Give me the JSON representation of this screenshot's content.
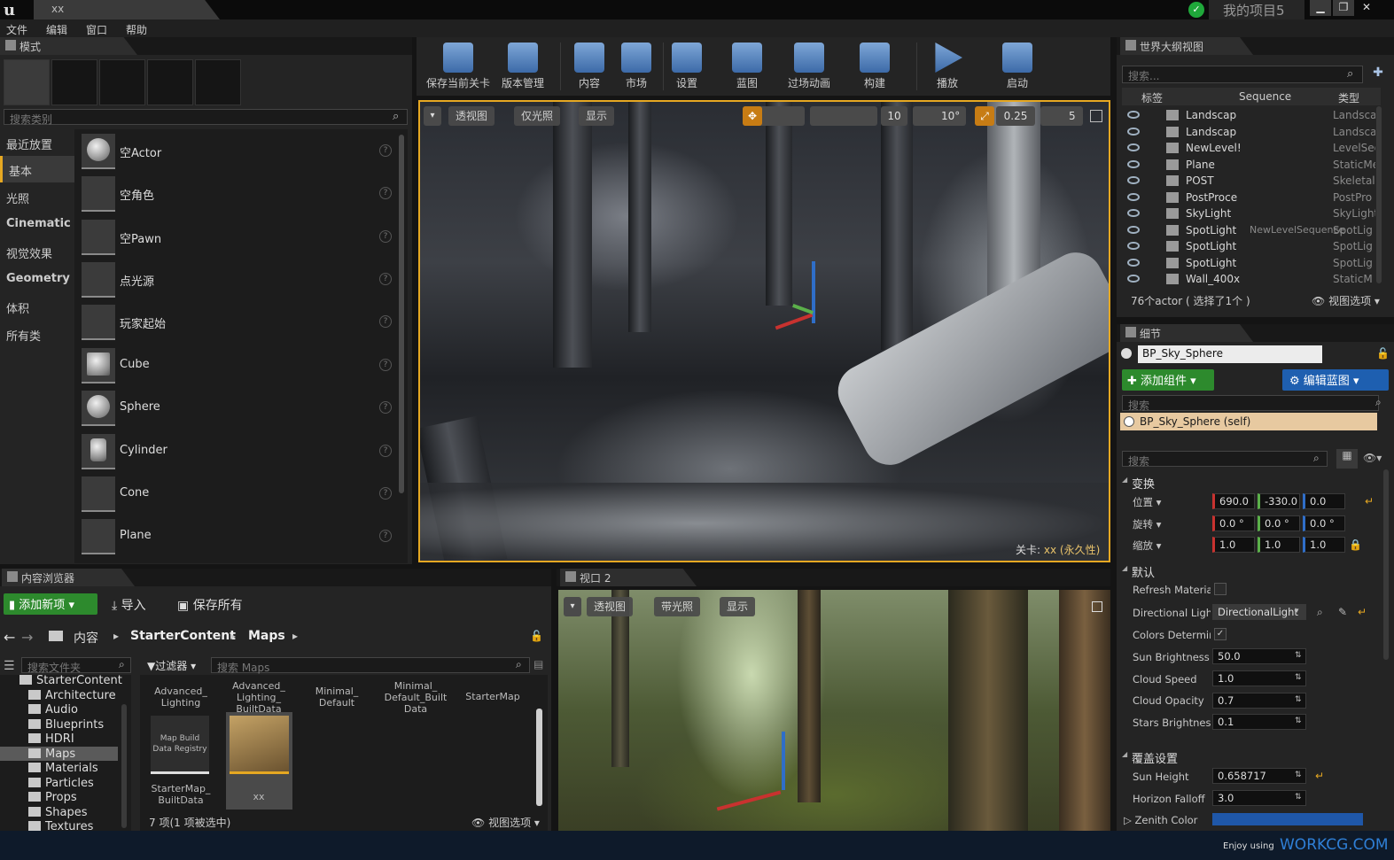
{
  "titlebar": {
    "doc_tab": "xx",
    "project": "我的项目5"
  },
  "menu": [
    "文件",
    "编辑",
    "窗口",
    "帮助"
  ],
  "modes": {
    "tab": "模式",
    "search_placeholder": "搜索类别",
    "categories": [
      "最近放置",
      "基本",
      "光照",
      "Cinematic",
      "视觉效果",
      "Geometry",
      "体积",
      "所有类"
    ],
    "items": [
      "空Actor",
      "空角色",
      "空Pawn",
      "点光源",
      "玩家起始",
      "Cube",
      "Sphere",
      "Cylinder",
      "Cone",
      "Plane"
    ]
  },
  "toolbar": [
    "保存当前关卡",
    "版本管理",
    "内容",
    "市场",
    "设置",
    "蓝图",
    "过场动画",
    "构建",
    "播放",
    "启动"
  ],
  "viewport1": {
    "perspective": "透视图",
    "lit": "仅光照",
    "show": "显示",
    "grid_snap": "10",
    "rot_snap": "10°",
    "scale_snap": "0.25",
    "cam_speed": "5",
    "level_prefix": "关卡:",
    "level_name": "xx (永久性)"
  },
  "viewport2": {
    "tab": "视口 2",
    "perspective": "透视图",
    "lit": "带光照",
    "show": "显示"
  },
  "outliner": {
    "tab": "世界大纲视图",
    "search_placeholder": "搜索...",
    "col_label": "标签",
    "col_sequence": "Sequence",
    "col_type": "类型",
    "rows": [
      {
        "name": "Landscap",
        "seq": "",
        "type": "Landscape"
      },
      {
        "name": "Landscap",
        "seq": "",
        "type": "Landscape"
      },
      {
        "name": "NewLevel!",
        "seq": "",
        "type": "LevelSeq"
      },
      {
        "name": "Plane",
        "seq": "",
        "type": "StaticMesh"
      },
      {
        "name": "POST",
        "seq": "",
        "type": "Skeletal"
      },
      {
        "name": "PostProce",
        "seq": "",
        "type": "PostPro"
      },
      {
        "name": "SkyLight",
        "seq": "",
        "type": "SkyLight"
      },
      {
        "name": "SpotLight",
        "seq": "NewLevelSequence",
        "type": "SpotLig"
      },
      {
        "name": "SpotLight",
        "seq": "",
        "type": "SpotLig"
      },
      {
        "name": "SpotLight",
        "seq": "",
        "type": "SpotLig"
      },
      {
        "name": "Wall_400x",
        "seq": "",
        "type": "StaticM"
      }
    ],
    "status": "76个actor ( 选择了1个 )",
    "view_options": "视图选项"
  },
  "details": {
    "tab": "细节",
    "actor_name": "BP_Sky_Sphere",
    "add_component": "添加组件",
    "edit_blueprint": "编辑蓝图",
    "search1": "搜索",
    "self_component": "BP_Sky_Sphere (self)",
    "search2": "搜索",
    "transform": {
      "header": "变换",
      "location_label": "位置",
      "rotation_label": "旋转",
      "scale_label": "缩放",
      "location": [
        "690.0",
        "-330.0",
        "0.0"
      ],
      "rotation": [
        "0.0 °",
        "0.0 °",
        "0.0 °"
      ],
      "scale": [
        "1.0",
        "1.0",
        "1.0"
      ]
    },
    "default": {
      "header": "默认",
      "refresh_material": "Refresh Materia",
      "directional_light_label": "Directional Light",
      "directional_light_value": "DirectionalLight",
      "colors_determined": "Colors Determin",
      "sun_brightness_label": "Sun Brightness",
      "sun_brightness": "50.0",
      "cloud_speed_label": "Cloud Speed",
      "cloud_speed": "1.0",
      "cloud_opacity_label": "Cloud Opacity",
      "cloud_opacity": "0.7",
      "stars_brightness_label": "Stars Brightness",
      "stars_brightness": "0.1"
    },
    "override": {
      "header": "覆盖设置",
      "sun_height_label": "Sun Height",
      "sun_height": "0.658717",
      "horizon_falloff_label": "Horizon Falloff",
      "horizon_falloff": "3.0",
      "zenith_color_label": "Zenith Color",
      "zenith_color": "#1f57a8"
    }
  },
  "content_browser": {
    "tab": "内容浏览器",
    "add_new": "添加新项",
    "import": "导入",
    "save_all": "保存所有",
    "path": [
      "内容",
      "StarterContent",
      "Maps"
    ],
    "folder_search": "搜索文件夹",
    "filters": "过滤器",
    "search_maps": "搜索 Maps",
    "tree": [
      "StarterContent",
      "Architecture",
      "Audio",
      "Blueprints",
      "HDRI",
      "Maps",
      "Materials",
      "Particles",
      "Props",
      "Shapes",
      "Textures"
    ],
    "assets": [
      "Advanced_\nLighting",
      "Advanced_\nLighting_\nBuiltData",
      "Minimal_\nDefault",
      "Minimal_\nDefault_Built\nData",
      "StarterMap",
      "StarterMap_\nBuiltData",
      "xx"
    ],
    "registry_thumb": "Map Build\nData Registry",
    "status": "7 项(1 项被选中)",
    "view_options": "视图选项"
  },
  "watermark": {
    "prefix": "Enjoy using",
    "site": "WORKCG.COM"
  }
}
